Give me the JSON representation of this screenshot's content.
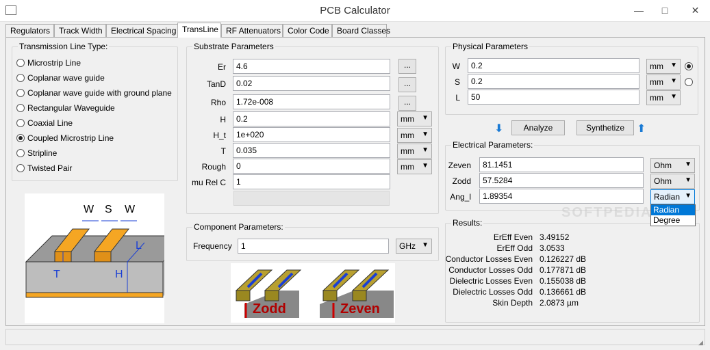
{
  "window": {
    "title": "PCB Calculator",
    "minimize": "—",
    "maximize": "□",
    "close": "✕"
  },
  "tabs": [
    "Regulators",
    "Track Width",
    "Electrical Spacing",
    "TransLine",
    "RF Attenuators",
    "Color Code",
    "Board Classes"
  ],
  "line_type": {
    "title": "Transmission Line Type:",
    "options": [
      "Microstrip Line",
      "Coplanar wave guide",
      "Coplanar wave guide with ground plane",
      "Rectangular Waveguide",
      "Coaxial Line",
      "Coupled Microstrip Line",
      "Stripline",
      "Twisted Pair"
    ],
    "selected": "Coupled Microstrip Line"
  },
  "diagram_left": {
    "w1": "W",
    "s": "S",
    "w2": "W",
    "t": "T",
    "h": "H",
    "l": "L"
  },
  "substrate": {
    "title": "Substrate Parameters",
    "rows": [
      {
        "label": "Er",
        "value": "4.6",
        "button": "..."
      },
      {
        "label": "TanD",
        "value": "0.02",
        "button": "..."
      },
      {
        "label": "Rho",
        "value": "1.72e-008",
        "button": "..."
      },
      {
        "label": "H",
        "value": "0.2",
        "unit": "mm"
      },
      {
        "label": "H_t",
        "value": "1e+020",
        "unit": "mm"
      },
      {
        "label": "T",
        "value": "0.035",
        "unit": "mm"
      },
      {
        "label": "Rough",
        "value": "0",
        "unit": "mm"
      },
      {
        "label": "mu Rel C",
        "value": "1"
      }
    ]
  },
  "component": {
    "title": "Component Parameters:",
    "freq_label": "Frequency",
    "freq_value": "1",
    "freq_unit": "GHz"
  },
  "physical": {
    "title": "Physical Parameters",
    "rows": [
      {
        "label": "W",
        "value": "0.2",
        "unit": "mm"
      },
      {
        "label": "S",
        "value": "0.2",
        "unit": "mm"
      },
      {
        "label": "L",
        "value": "50",
        "unit": "mm"
      }
    ]
  },
  "actions": {
    "analyze": "Analyze",
    "synthetize": "Synthetize"
  },
  "electrical": {
    "title": "Electrical Parameters:",
    "rows": [
      {
        "label": "Zeven",
        "value": "81.1451",
        "unit": "Ohm"
      },
      {
        "label": "Zodd",
        "value": "57.5284",
        "unit": "Ohm"
      },
      {
        "label": "Ang_l",
        "value": "1.89354",
        "unit": "Radian"
      }
    ],
    "dropdown_options": [
      "Radian",
      "Degree"
    ]
  },
  "results": {
    "title": "Results:",
    "rows": [
      {
        "label": "ErEff Even",
        "value": "3.49152"
      },
      {
        "label": "ErEff Odd",
        "value": "3.0533"
      },
      {
        "label": "Conductor Losses Even",
        "value": "0.126227 dB"
      },
      {
        "label": "Conductor Losses Odd",
        "value": "0.177871 dB"
      },
      {
        "label": "Dielectric Losses Even",
        "value": "0.155038 dB"
      },
      {
        "label": "Dielectric Losses Odd",
        "value": "0.136661 dB"
      },
      {
        "label": "Skin Depth",
        "value": "2.0873 µm"
      }
    ]
  },
  "diagram_bottom": {
    "zodd": "Zodd",
    "zeven": "Zeven"
  },
  "watermark": "SOFTPEDIA",
  "colors": {
    "selection": "#0078d7",
    "copper": "#f5a623",
    "substrate_top": "#9a9a9a",
    "ground": "#f5a623"
  }
}
